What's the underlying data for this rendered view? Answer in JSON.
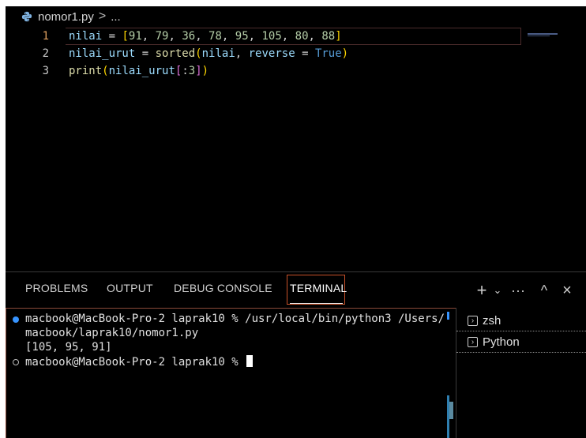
{
  "breadcrumb": {
    "file": "nomor1.py",
    "separator": ">",
    "more": "..."
  },
  "editor": {
    "lines": [
      {
        "number": "1",
        "text": "nilai = [91, 79, 36, 78, 95, 105, 80, 88]"
      },
      {
        "number": "2",
        "text": "nilai_urut = sorted(nilai, reverse = True)"
      },
      {
        "number": "3",
        "text": "print(nilai_urut[:3])"
      }
    ]
  },
  "panel": {
    "tabs": [
      "PROBLEMS",
      "OUTPUT",
      "DEBUG CONSOLE",
      "TERMINAL"
    ],
    "active_tab": "TERMINAL",
    "actions": {
      "add": "+",
      "dropdown": "⌄",
      "more": "···",
      "maximize": "^",
      "close": "×"
    }
  },
  "terminal": {
    "lines": [
      "macbook@MacBook-Pro-2 laprak10 % /usr/local/bin/python3 /Users/",
      "macbook/laprak10/nomor1.py",
      "[105, 95, 91]",
      "macbook@MacBook-Pro-2 laprak10 % "
    ],
    "sessions": [
      "zsh",
      "Python"
    ]
  },
  "colors": {
    "accent": "#3794ff",
    "focus_outline": "#c8522a",
    "background": "#000000"
  }
}
